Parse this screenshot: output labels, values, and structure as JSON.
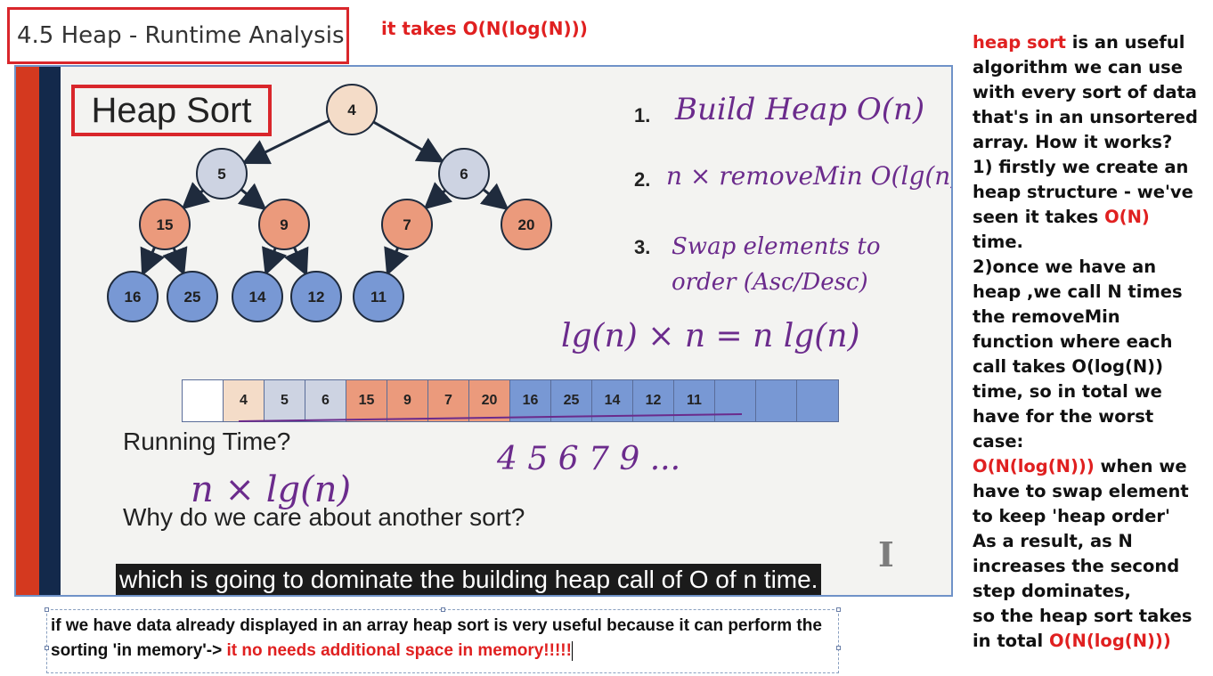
{
  "header": {
    "title": "4.5 Heap - Runtime Analysis",
    "note": "it takes O(N(log(N)))"
  },
  "slide": {
    "heading": "Heap Sort",
    "tree": [
      {
        "label": "4",
        "color": "#f4dcc8"
      },
      {
        "label": "5",
        "color": "#cdd3e2"
      },
      {
        "label": "6",
        "color": "#cdd3e2"
      },
      {
        "label": "15",
        "color": "#eb9a7c"
      },
      {
        "label": "9",
        "color": "#eb9a7c"
      },
      {
        "label": "7",
        "color": "#eb9a7c"
      },
      {
        "label": "20",
        "color": "#eb9a7c"
      },
      {
        "label": "16",
        "color": "#7898d4"
      },
      {
        "label": "25",
        "color": "#7898d4"
      },
      {
        "label": "14",
        "color": "#7898d4"
      },
      {
        "label": "12",
        "color": "#7898d4"
      },
      {
        "label": "11",
        "color": "#7898d4"
      }
    ],
    "array": [
      {
        "label": "",
        "color": "#ffffff"
      },
      {
        "label": "4",
        "color": "#f4dcc8"
      },
      {
        "label": "5",
        "color": "#cdd3e2"
      },
      {
        "label": "6",
        "color": "#cdd3e2"
      },
      {
        "label": "15",
        "color": "#eb9a7c"
      },
      {
        "label": "9",
        "color": "#eb9a7c"
      },
      {
        "label": "7",
        "color": "#eb9a7c"
      },
      {
        "label": "20",
        "color": "#eb9a7c"
      },
      {
        "label": "16",
        "color": "#7898d4"
      },
      {
        "label": "25",
        "color": "#7898d4"
      },
      {
        "label": "14",
        "color": "#7898d4"
      },
      {
        "label": "12",
        "color": "#7898d4"
      },
      {
        "label": "11",
        "color": "#7898d4"
      },
      {
        "label": "",
        "color": "#7898d4"
      },
      {
        "label": "",
        "color": "#7898d4"
      },
      {
        "label": "",
        "color": "#7898d4"
      }
    ],
    "running_time": "Running Time?",
    "why": "Why do we care about another sort?",
    "steps": [
      {
        "num": "1.",
        "text": "Build Heap O(n)"
      },
      {
        "num": "2.",
        "text": "n × removeMin O(lg(n))"
      },
      {
        "num": "3.",
        "text": "Swap elements to order (Asc/Desc)"
      }
    ],
    "math": "lg(n) × n = n lg(n)",
    "running_answer": "n × lg(n)",
    "sequence": "4  5  6  7  9  ...",
    "subtitle": "which is going to dominate the building heap call of O of n time.",
    "logo": "I"
  },
  "notes": {
    "text": "if we have data already displayed in an array heap sort is very useful because it can perform the sorting 'in memory'-> ",
    "highlight": "it no needs additional space in memory!!!!!"
  },
  "sidebar": {
    "p1_red": "heap sort",
    "p1": " is an useful algorithm we can use with every sort of data that's in an unsortered array. How it works?",
    "p2": "1) firstly we create an heap structure - we've seen it takes ",
    "p2_red": "O(N)",
    "p2_end": " time.",
    "p3": "2)once we have an heap ,we call N times the removeMin function where each call takes O(log(N)) time, so in total we have for the worst case:",
    "p4_red": "O(N(log(N)))",
    "p4": " when we have to swap element to keep 'heap order'",
    "p5": "As a result, as N increases the second step dominates,",
    "p6": "so the heap sort takes in total ",
    "p6_red": "O(N(log(N)))"
  },
  "colors": {
    "accent_red": "#e02020",
    "handwriting": "#6b2b8c",
    "slide_border": "#6f92c8"
  }
}
